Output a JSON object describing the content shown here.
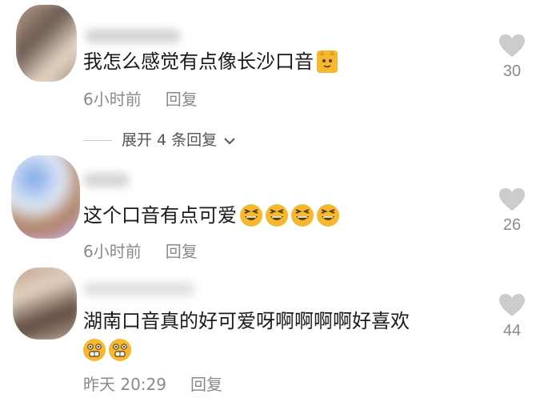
{
  "comments": [
    {
      "text": "我怎么感觉有点像长沙口音",
      "time": "6小时前",
      "reply_label": "回复",
      "like_count": "30",
      "emojis": [
        "cat-emoji"
      ]
    },
    {
      "text": "这个口音有点可爱",
      "time": "6小时前",
      "reply_label": "回复",
      "like_count": "26",
      "emojis": [
        "laughing-emoji",
        "laughing-emoji",
        "laughing-emoji",
        "laughing-emoji"
      ]
    },
    {
      "text": "湖南口音真的好可爱呀啊啊啊啊好喜欢",
      "time": "昨天 20:29",
      "reply_label": "回复",
      "like_count": "44",
      "emojis": [
        "grinning-emoji",
        "grinning-emoji"
      ]
    }
  ],
  "expand_replies": "展开 4 条回复",
  "colors": {
    "text": "#1a1a1a",
    "meta": "#8a8a8a",
    "heart": "#cccccc",
    "emoji_yellow": "#f5b82e"
  }
}
